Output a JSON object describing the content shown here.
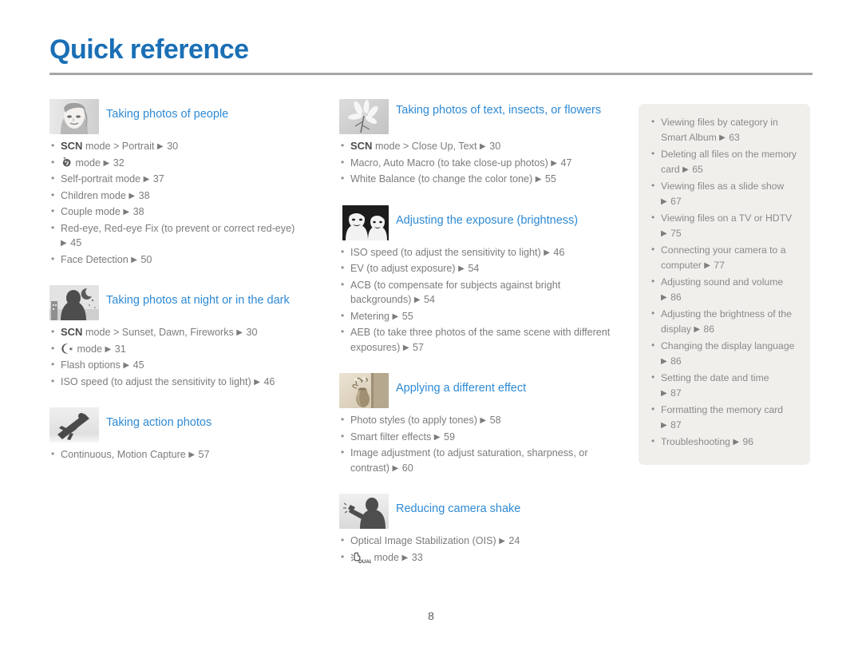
{
  "header": {
    "title": "Quick reference"
  },
  "page_number": "8",
  "colors": {
    "title_blue": "#1a6fb5",
    "section_blue": "#2e8ad4",
    "body_gray": "#7c7c7c",
    "rule_gray": "#a6a6a6",
    "infobox_bg": "#f1efec"
  },
  "columns": {
    "left": [
      {
        "icon": "portrait-woman-thumbnail",
        "title": "Taking photos of people",
        "items": [
          {
            "prefix_bold": "SCN",
            "text": " mode > Portrait",
            "arrow": "▶",
            "page": "30"
          },
          {
            "glyph": "beauty-shot-icon",
            "text": " mode",
            "arrow": "▶",
            "page": "32"
          },
          {
            "text": "Self-portrait mode",
            "arrow": "▶",
            "page": "37"
          },
          {
            "text": "Children mode",
            "arrow": "▶",
            "page": "38"
          },
          {
            "text": "Couple mode",
            "arrow": "▶",
            "page": "38"
          },
          {
            "text": "Red-eye, Red-eye Fix (to prevent or correct red-eye)",
            "wrap": true,
            "arrow": "▶",
            "page": "45"
          },
          {
            "text": "Face Detection",
            "arrow": "▶",
            "page": "50"
          }
        ]
      },
      {
        "icon": "night-scene-thumbnail",
        "title": "Taking photos at night or in the dark",
        "items": [
          {
            "prefix_bold": "SCN",
            "text": " mode > Sunset, Dawn, Fireworks",
            "arrow": "▶",
            "page": "30"
          },
          {
            "glyph": "night-mode-icon",
            "text": " mode",
            "arrow": "▶",
            "page": "31"
          },
          {
            "text": "Flash options",
            "arrow": "▶",
            "page": "45"
          },
          {
            "text": "ISO speed (to adjust the sensitivity to light)",
            "arrow": "▶",
            "page": "46"
          }
        ]
      },
      {
        "icon": "snowboarder-thumbnail",
        "title": "Taking action photos",
        "items": [
          {
            "text": "Continuous, Motion Capture",
            "arrow": "▶",
            "page": "57"
          }
        ]
      }
    ],
    "middle": [
      {
        "icon": "flower-thumbnail",
        "title": "Taking photos of text, insects, or flowers",
        "two_line": true,
        "items": [
          {
            "prefix_bold": "SCN",
            "text": " mode > Close Up, Text",
            "arrow": "▶",
            "page": "30"
          },
          {
            "text": "Macro, Auto Macro (to take close-up photos)",
            "arrow": "▶",
            "page": "47"
          },
          {
            "text": "White Balance (to change the color tone)",
            "arrow": "▶",
            "page": "55"
          }
        ]
      },
      {
        "icon": "two-faces-thumbnail",
        "title": "Adjusting the exposure (brightness)",
        "items": [
          {
            "text": "ISO speed (to adjust the sensitivity to light)",
            "arrow": "▶",
            "page": "46"
          },
          {
            "text": "EV (to adjust exposure)",
            "arrow": "▶",
            "page": "54"
          },
          {
            "text": "ACB (to compensate for subjects against bright backgrounds)",
            "arrow": "▶",
            "page": "54"
          },
          {
            "text": "Metering",
            "arrow": "▶",
            "page": "55"
          },
          {
            "text": "AEB (to take three photos of the same scene with different exposures)",
            "arrow": "▶",
            "page": "57"
          }
        ]
      },
      {
        "icon": "vase-sepia-thumbnail",
        "title": "Applying a different effect",
        "items": [
          {
            "text": "Photo styles (to apply tones)",
            "arrow": "▶",
            "page": "58"
          },
          {
            "text": "Smart filter effects",
            "arrow": "▶",
            "page": "59"
          },
          {
            "text": "Image adjustment (to adjust saturation, sharpness, or contrast)",
            "arrow": "▶",
            "page": "60"
          }
        ]
      },
      {
        "icon": "person-waving-thumbnail",
        "title": "Reducing camera shake",
        "items": [
          {
            "text": "Optical Image Stabilization (OIS)",
            "arrow": "▶",
            "page": "24"
          },
          {
            "glyph": "dual-is-icon",
            "text": " mode",
            "arrow": "▶",
            "page": "33"
          }
        ]
      }
    ],
    "right_box": [
      {
        "text": "Viewing files by category in Smart Album",
        "arrow": "▶",
        "page": "63"
      },
      {
        "text": "Deleting all files on the memory card",
        "arrow": "▶",
        "page": "65"
      },
      {
        "text": "Viewing files as a slide show",
        "arrow": "▶",
        "page": "67",
        "break_before_arrow": true
      },
      {
        "text": "Viewing files on a TV or HDTV",
        "arrow": "▶",
        "page": "75",
        "break_before_arrow": true
      },
      {
        "text": "Connecting your camera to a computer",
        "arrow": "▶",
        "page": "77"
      },
      {
        "text": "Adjusting sound and volume",
        "arrow": "▶",
        "page": "86",
        "break_before_arrow": true
      },
      {
        "text": "Adjusting the brightness of the display",
        "arrow": "▶",
        "page": "86"
      },
      {
        "text": "Changing the display language",
        "arrow": "▶",
        "page": "86"
      },
      {
        "text": "Setting the date and time",
        "arrow": "▶",
        "page": "87",
        "break_before_arrow": true
      },
      {
        "text": "Formatting the memory card",
        "arrow": "▶",
        "page": "87",
        "break_before_arrow": true
      },
      {
        "text": "Troubleshooting",
        "arrow": "▶",
        "page": "96"
      }
    ]
  }
}
